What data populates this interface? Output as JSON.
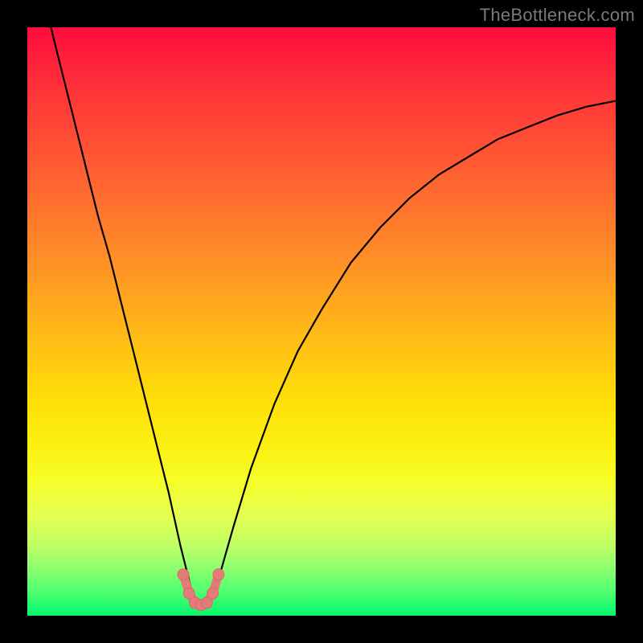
{
  "watermark": "TheBottleneck.com",
  "colors": {
    "frame": "#000000",
    "gradient_top": "#ff0b3e",
    "gradient_bottom": "#0cf56c",
    "curve_stroke": "#000000",
    "marker_fill": "#e37b78",
    "marker_stroke": "#d66a66"
  },
  "chart_data": {
    "type": "line",
    "title": "",
    "xlabel": "",
    "ylabel": "",
    "xlim": [
      0,
      100
    ],
    "ylim": [
      0,
      100
    ],
    "note": "Axes are unlabeled; x and y are normalized 0–100 estimated from pixel positions. y=0 is bottom, y=100 is top. Curve is V-shaped with minimum near x≈29.",
    "series": [
      {
        "name": "bottleneck-curve",
        "x": [
          4,
          6,
          8,
          10,
          12,
          14,
          16,
          18,
          20,
          22,
          24,
          26,
          27,
          28,
          29,
          30,
          31,
          32,
          33,
          35,
          38,
          42,
          46,
          50,
          55,
          60,
          65,
          70,
          75,
          80,
          85,
          90,
          95,
          100
        ],
        "y": [
          100,
          92,
          84,
          76,
          68,
          61,
          53,
          45,
          37,
          29,
          21,
          12,
          8,
          4,
          2,
          2,
          3,
          5,
          8,
          15,
          25,
          36,
          45,
          52,
          60,
          66,
          71,
          75,
          78,
          81,
          83,
          85,
          86.5,
          87.5
        ]
      }
    ],
    "markers": {
      "name": "bottom-cluster",
      "note": "Salmon-colored connected dots near the curve minimum.",
      "x": [
        26.5,
        27.5,
        28.5,
        29.5,
        30.5,
        31.5,
        32.5
      ],
      "y": [
        7.0,
        3.8,
        2.2,
        1.8,
        2.2,
        3.8,
        7.0
      ]
    }
  }
}
